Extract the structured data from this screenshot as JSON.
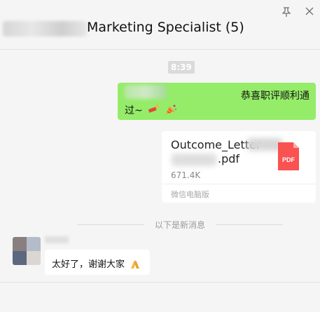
{
  "header": {
    "title": "Marketing Specialist (5)",
    "pin_icon": "pin-icon",
    "close_icon": "close-icon"
  },
  "chat": {
    "timestamp": "8:39",
    "outgoing_message": {
      "text_line1": "恭喜职评顺利通",
      "text_line2": "过~",
      "emojis": [
        "firecracker-emoji",
        "party-popper-emoji"
      ]
    },
    "file_message": {
      "name_part": "Outcome_Letter",
      "ext": ".pdf",
      "size": "671.4K",
      "source": "微信电脑版",
      "icon_label": "PDF"
    },
    "new_messages_divider": "以下是新消息",
    "incoming_message": {
      "text": "太好了，谢谢大家",
      "emoji": "thanks-emoji"
    }
  },
  "colors": {
    "outgoing_bubble": "#95ec69",
    "pdf_red": "#fa5151",
    "background": "#f5f5f5"
  }
}
